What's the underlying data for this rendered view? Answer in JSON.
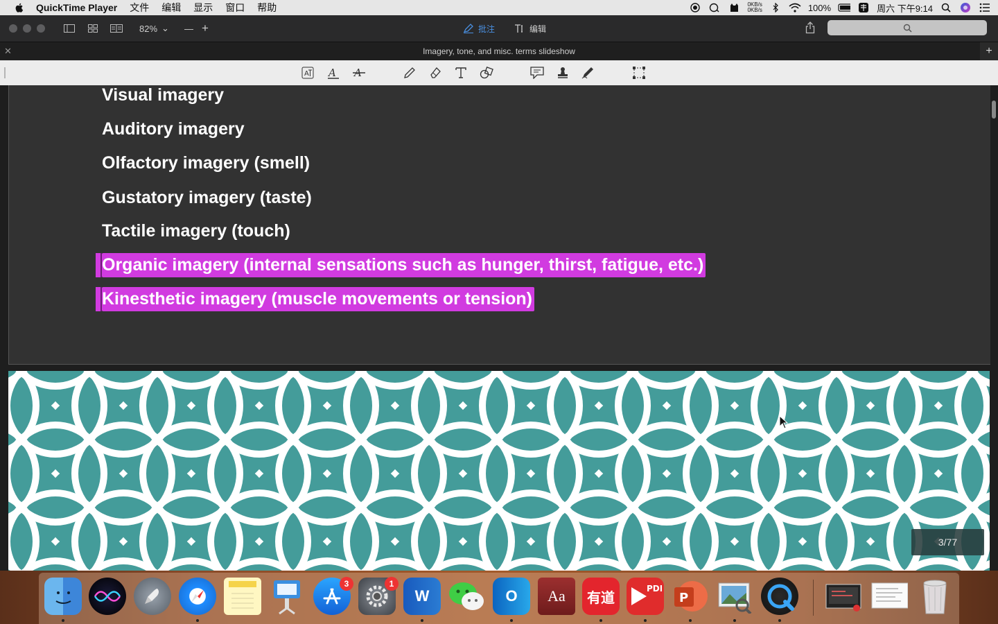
{
  "menubar": {
    "app_name": "QuickTime Player",
    "items": [
      "文件",
      "编辑",
      "显示",
      "窗口",
      "帮助"
    ],
    "status": {
      "net_up": "0KB/s",
      "net_down": "0KB/s",
      "battery": "100%",
      "datetime": "周六 下午9:14"
    }
  },
  "toolbar": {
    "zoom": "82%",
    "mode_annotate": "批注",
    "mode_edit": "编辑"
  },
  "tab": {
    "title": "Imagery, tone, and misc. terms slideshow"
  },
  "annotation_tools": [
    "translate-icon",
    "highlight-text-icon",
    "strikethrough-icon",
    "pencil-icon",
    "eraser-icon",
    "text-tool-icon",
    "shapes-icon",
    "comment-icon",
    "stamp-icon",
    "signature-icon",
    "select-area-icon"
  ],
  "slide": {
    "bullets": [
      {
        "text": "Visual imagery",
        "highlighted": false
      },
      {
        "text": "Auditory imagery",
        "highlighted": false
      },
      {
        "text": "Olfactory imagery (smell)",
        "highlighted": false
      },
      {
        "text": "Gustatory imagery (taste)",
        "highlighted": false
      },
      {
        "text": "Tactile imagery (touch)",
        "highlighted": false
      },
      {
        "text": "Organic imagery (internal sensations such as hunger, thirst, fatigue, etc.)",
        "highlighted": true
      },
      {
        "text": "Kinesthetic imagery (muscle movements or tension)",
        "highlighted": true
      }
    ],
    "highlight_color": "#d13be0",
    "next_slide_bg": "#449c9a"
  },
  "page_indicator": "3/77",
  "dock": {
    "apps": [
      {
        "name": "finder",
        "badge": null
      },
      {
        "name": "siri",
        "badge": null
      },
      {
        "name": "launchpad",
        "badge": null
      },
      {
        "name": "safari",
        "badge": null
      },
      {
        "name": "notes",
        "badge": null
      },
      {
        "name": "keynote",
        "badge": null
      },
      {
        "name": "app-store",
        "badge": "3"
      },
      {
        "name": "system-preferences",
        "badge": "1"
      },
      {
        "name": "word",
        "badge": null
      },
      {
        "name": "wechat",
        "badge": null
      },
      {
        "name": "outlook",
        "badge": null
      },
      {
        "name": "dictionary",
        "badge": null
      },
      {
        "name": "youdao",
        "badge": null
      },
      {
        "name": "pdf-expert",
        "badge": null
      },
      {
        "name": "powerpoint",
        "badge": null
      },
      {
        "name": "preview",
        "badge": null
      },
      {
        "name": "quicktime",
        "badge": null
      }
    ],
    "labels": {
      "word": "W",
      "outlook": "O",
      "dictionary": "Aa",
      "youdao": "有道",
      "pdf": "PDF",
      "powerpoint": "P"
    },
    "badges": {
      "app_store": "3",
      "system_preferences": "1"
    }
  }
}
